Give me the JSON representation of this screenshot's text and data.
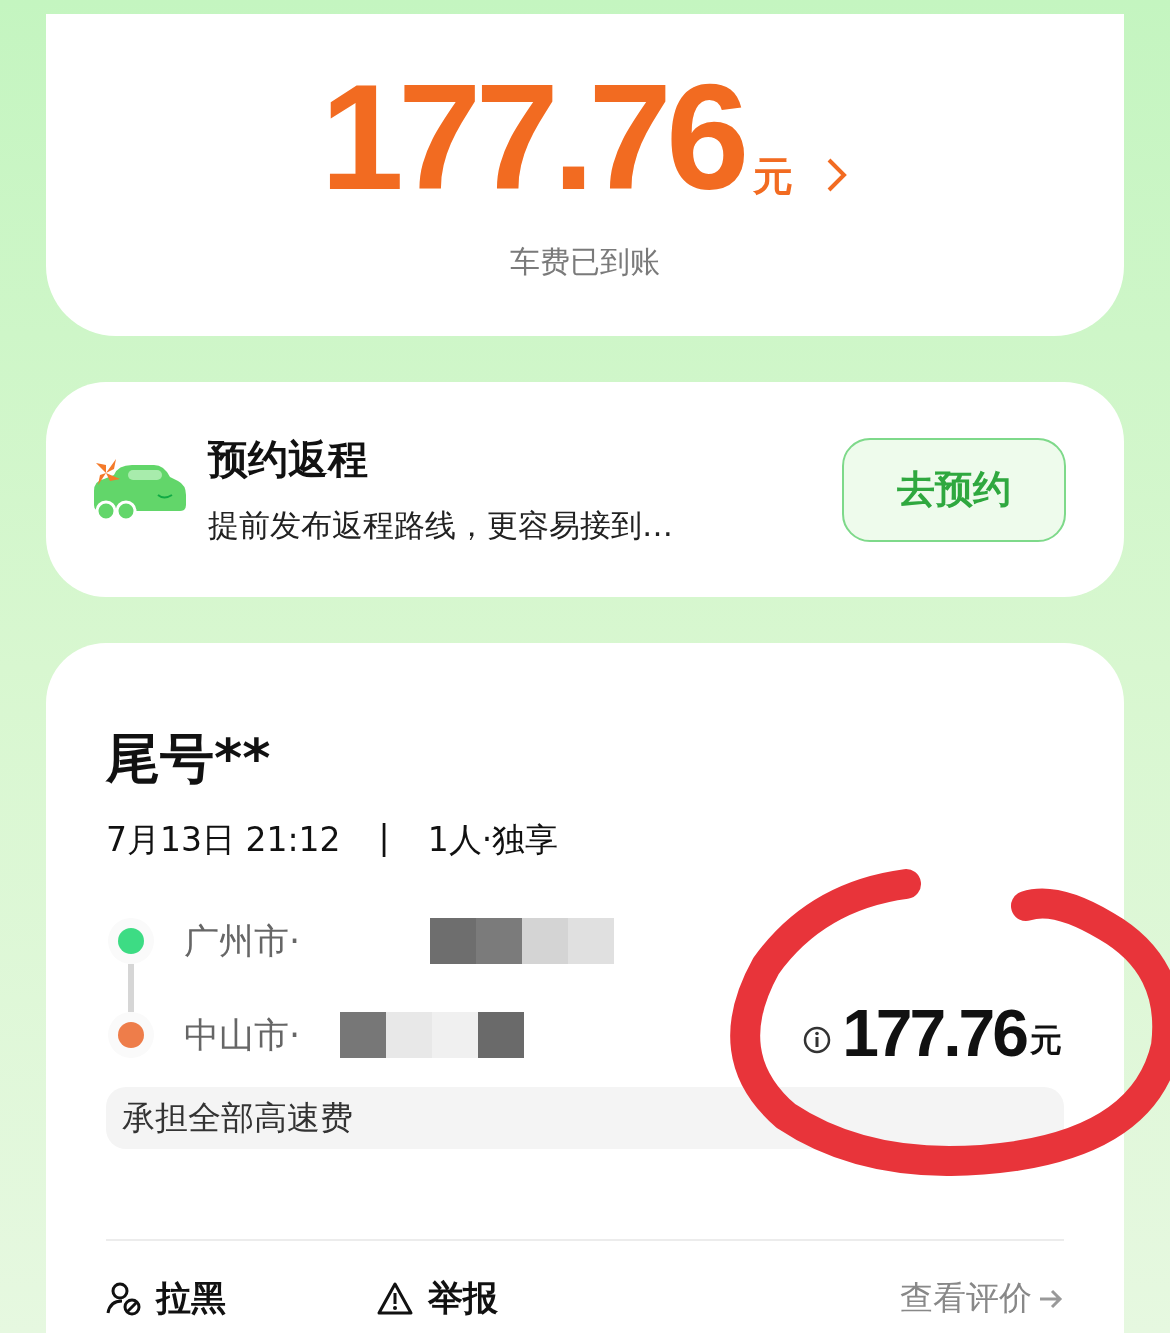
{
  "earnings": {
    "amount": "177.76",
    "unit": "元",
    "caption": "车费已到账"
  },
  "return_trip": {
    "title": "预约返程",
    "subtitle": "提前发布返程路线，更容易接到…",
    "button": "去预约"
  },
  "order": {
    "passenger": "尾号**",
    "time": "7月13日 21:12",
    "separator": "|",
    "seats": "1人·独享",
    "route": [
      {
        "kind": "start",
        "place": "广州市·",
        "color": "#3ddc84"
      },
      {
        "kind": "end",
        "place": "中山市·",
        "color": "#ee7d4a"
      }
    ],
    "fare": "177.76",
    "fare_unit": "元",
    "toll_note": "承担全部高速费"
  },
  "actions": [
    {
      "kind": "block",
      "label": "拉黑"
    },
    {
      "kind": "report",
      "label": "举报"
    }
  ],
  "review_link": "查看评价"
}
